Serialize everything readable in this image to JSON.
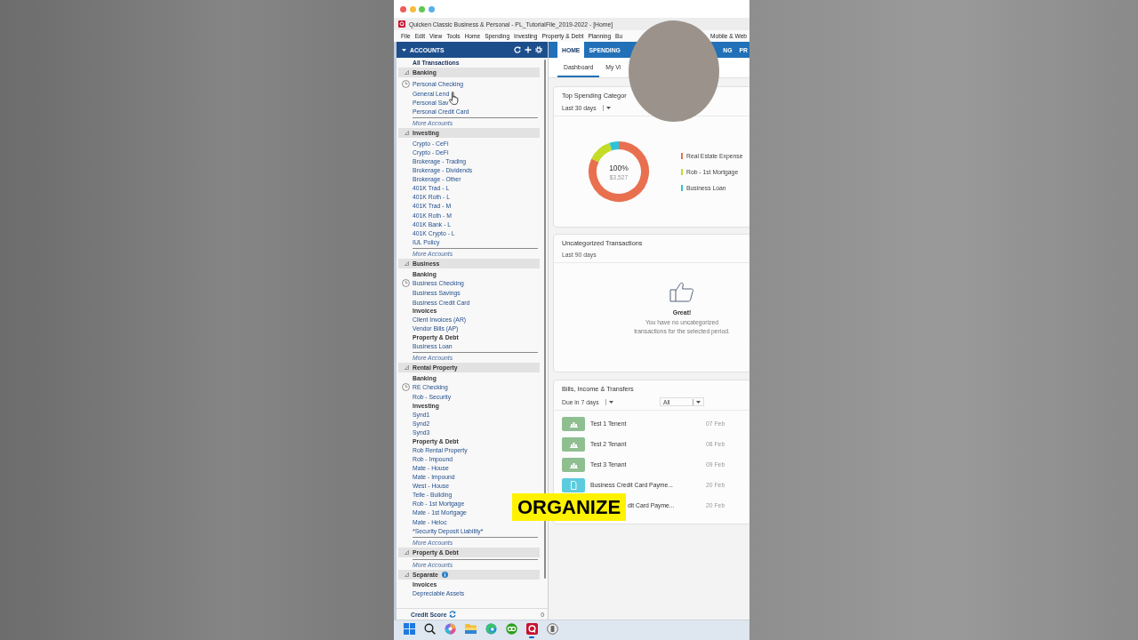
{
  "window": {
    "title": "Quicken Classic Business & Personal - PL_TutorialFile_2019-2022 - [Home]"
  },
  "menu": [
    "File",
    "Edit",
    "View",
    "Tools",
    "Home",
    "Spending",
    "Investing",
    "Property & Debt",
    "Planning",
    "Bu",
    "Mobile & Web"
  ],
  "accounts": {
    "header": "ACCOUNTS",
    "all_transactions": "All Transactions",
    "groups": [
      {
        "name": "Banking",
        "info": false,
        "items": [
          {
            "kind": "scheduled",
            "label": "Personal Checking"
          },
          {
            "kind": "account",
            "label": "General Lend"
          },
          {
            "kind": "account",
            "label": "Personal Sav"
          },
          {
            "kind": "account",
            "label": "Personal Credit Card"
          },
          {
            "kind": "more",
            "label": "More Accounts"
          }
        ]
      },
      {
        "name": "Investing",
        "info": false,
        "items": [
          {
            "kind": "account",
            "label": "Crypto - CeFi"
          },
          {
            "kind": "account",
            "label": "Crypto - DeFi"
          },
          {
            "kind": "account",
            "label": "Brokerage - Trading"
          },
          {
            "kind": "account",
            "label": "Brokerage - Dividends"
          },
          {
            "kind": "account",
            "label": "Brokerage - Other"
          },
          {
            "kind": "account",
            "label": "401K Trad - L"
          },
          {
            "kind": "account",
            "label": "401K Roth - L"
          },
          {
            "kind": "account",
            "label": "401K Trad - M"
          },
          {
            "kind": "account",
            "label": "401K Roth - M"
          },
          {
            "kind": "account",
            "label": "401K Bank - L"
          },
          {
            "kind": "account",
            "label": "401K Crypto - L"
          },
          {
            "kind": "account",
            "label": "IUL Policy"
          },
          {
            "kind": "more",
            "label": "More Accounts"
          }
        ]
      },
      {
        "name": "Business",
        "info": false,
        "items": [
          {
            "kind": "heading",
            "label": "Banking"
          },
          {
            "kind": "scheduled",
            "label": "Business Checking"
          },
          {
            "kind": "account",
            "label": "Business Savings"
          },
          {
            "kind": "account",
            "label": "Business Credit Card"
          },
          {
            "kind": "heading",
            "label": "Invoices"
          },
          {
            "kind": "account",
            "label": "Client Invoices (AR)"
          },
          {
            "kind": "account",
            "label": "Vendor Bills (AP)"
          },
          {
            "kind": "heading",
            "label": "Property & Debt"
          },
          {
            "kind": "account",
            "label": "Business Loan"
          },
          {
            "kind": "more",
            "label": "More Accounts"
          }
        ]
      },
      {
        "name": "Rental Property",
        "info": false,
        "items": [
          {
            "kind": "heading",
            "label": "Banking"
          },
          {
            "kind": "scheduled",
            "label": "RE Checking"
          },
          {
            "kind": "account",
            "label": "Rob - Security"
          },
          {
            "kind": "heading",
            "label": "Investing"
          },
          {
            "kind": "account",
            "label": "Synd1"
          },
          {
            "kind": "account",
            "label": "Synd2"
          },
          {
            "kind": "account",
            "label": "Synd3"
          },
          {
            "kind": "heading",
            "label": "Property & Debt"
          },
          {
            "kind": "account",
            "label": "Rob Rental Property"
          },
          {
            "kind": "account",
            "label": "Rob - Impound"
          },
          {
            "kind": "account",
            "label": "Mate - House"
          },
          {
            "kind": "account",
            "label": "Mate - Impound"
          },
          {
            "kind": "account",
            "label": "West - House"
          },
          {
            "kind": "account",
            "label": "Telle - Building"
          },
          {
            "kind": "account",
            "label": "Rob - 1st Mortgage"
          },
          {
            "kind": "account",
            "label": "Mate - 1st Mortgage"
          },
          {
            "kind": "account",
            "label": "Mate - Heloc"
          },
          {
            "kind": "account",
            "label": "*Security Deposit Liability*"
          },
          {
            "kind": "more",
            "label": "More Accounts"
          }
        ]
      },
      {
        "name": "Property & Debt",
        "info": false,
        "items": [
          {
            "kind": "more",
            "label": "More Accounts"
          }
        ]
      },
      {
        "name": "Separate",
        "info": true,
        "items": [
          {
            "kind": "heading",
            "label": "Invoices"
          },
          {
            "kind": "account",
            "label": "Depreciable Assets"
          }
        ]
      }
    ],
    "footer": {
      "label": "Credit Score",
      "value": "0"
    }
  },
  "tabs": [
    {
      "label": "HOME",
      "selected": true
    },
    {
      "label": "SPENDING",
      "selected": false
    },
    {
      "label": "NG",
      "selected": false
    },
    {
      "label": "PR",
      "selected": false
    }
  ],
  "subtabs": [
    {
      "label": "Dashboard",
      "selected": true
    },
    {
      "label": "My Vi",
      "selected": false
    }
  ],
  "top_spending": {
    "title": "Top Spending Categor",
    "period": "Last 30 days",
    "total_percent": "100%",
    "total_amount": "$3,527",
    "legend": [
      {
        "label": "Real Estate Expense",
        "color": "#e8704f"
      },
      {
        "label": "Rob - 1st Mortgage",
        "color": "#c4dc28"
      },
      {
        "label": "Business Loan",
        "color": "#2ec2d8"
      }
    ]
  },
  "uncategorized": {
    "title": "Uncategorized Transactions",
    "period": "Last 90 days",
    "heading": "Great!",
    "message": "You have no uncategorized transactions for the selected period."
  },
  "bills": {
    "title": "Bills, Income & Transfers",
    "due_filter": "Due in 7 days",
    "type_filter": "All",
    "rows": [
      {
        "kind": "income",
        "name": "Test 1 Tenent",
        "date": "07 Feb"
      },
      {
        "kind": "income",
        "name": "Test 2 Tenant",
        "date": "08 Feb"
      },
      {
        "kind": "income",
        "name": "Test 3 Tenant",
        "date": "09 Feb"
      },
      {
        "kind": "bill",
        "name": "Business Credit Card Payme...",
        "date": "20 Feb"
      },
      {
        "kind": "covered",
        "name": "dit Card Payme...",
        "date": "20 Feb"
      }
    ]
  },
  "caption": "ORGANIZE",
  "taskbar": [
    {
      "kind": "start",
      "selected": false
    },
    {
      "kind": "search",
      "selected": false
    },
    {
      "kind": "assistant",
      "selected": false
    },
    {
      "kind": "files",
      "selected": false
    },
    {
      "kind": "browser",
      "selected": false
    },
    {
      "kind": "bookkeeping",
      "selected": false
    },
    {
      "kind": "finance",
      "selected": true
    },
    {
      "kind": "utility",
      "selected": false
    }
  ]
}
